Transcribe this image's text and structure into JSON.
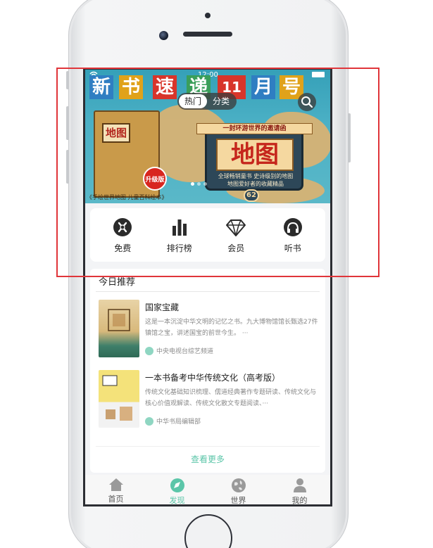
{
  "banner": {
    "status_time": "12:00",
    "title_chars": [
      "新",
      "书",
      "速",
      "递",
      "11",
      "月",
      "号"
    ],
    "title_colors": [
      "#2f7ec2",
      "#e0a21a",
      "#d8352a",
      "#3a9e5a",
      "#d8352a",
      "#2f7ec2",
      "#e0a21a"
    ],
    "tabs": [
      {
        "label": "热门",
        "active": true
      },
      {
        "label": "分类",
        "active": false
      }
    ],
    "book_title": "地图",
    "upgrade_badge": "升级版",
    "book_caption": "《手绘世界地图 儿童百科绘本》",
    "ribbon": "一封环游世界的邀请函",
    "big_title": "地图",
    "line1": "全球畅销童书 史诗级别的地图",
    "line2": "地图爱好者的收藏精品",
    "number": "62",
    "dot_count": 3,
    "active_dot": 0
  },
  "quick_nav": [
    {
      "label": "免费",
      "icon": "free-icon"
    },
    {
      "label": "排行榜",
      "icon": "bar-chart-icon"
    },
    {
      "label": "会员",
      "icon": "diamond-icon"
    },
    {
      "label": "听书",
      "icon": "headphones-icon"
    }
  ],
  "recommend": {
    "heading": "今日推荐",
    "books": [
      {
        "title": "国家宝藏",
        "desc": "这是一本沉淀中华文明的记忆之书。九大博物馆馆长甄选27件镇馆之宝，讲述国宝的前世今生。 ···",
        "author": "中央电视台综艺频道"
      },
      {
        "title": "一本书备考中华传统文化（高考版）",
        "desc": "传统文化基础知识梳理、儒道经典著作专题研读、传统文化与核心价值观解读、传统文化散文专题阅读、···",
        "author": "中华书局编辑部"
      }
    ],
    "more": "查看更多"
  },
  "tabbar": [
    {
      "label": "首页",
      "icon": "home-icon",
      "active": false
    },
    {
      "label": "发现",
      "icon": "compass-icon",
      "active": true
    },
    {
      "label": "世界",
      "icon": "globe-icon",
      "active": false
    },
    {
      "label": "我的",
      "icon": "user-icon",
      "active": false
    }
  ],
  "colors": {
    "accent": "#5cc6a9",
    "highlight": "#e0353a"
  }
}
